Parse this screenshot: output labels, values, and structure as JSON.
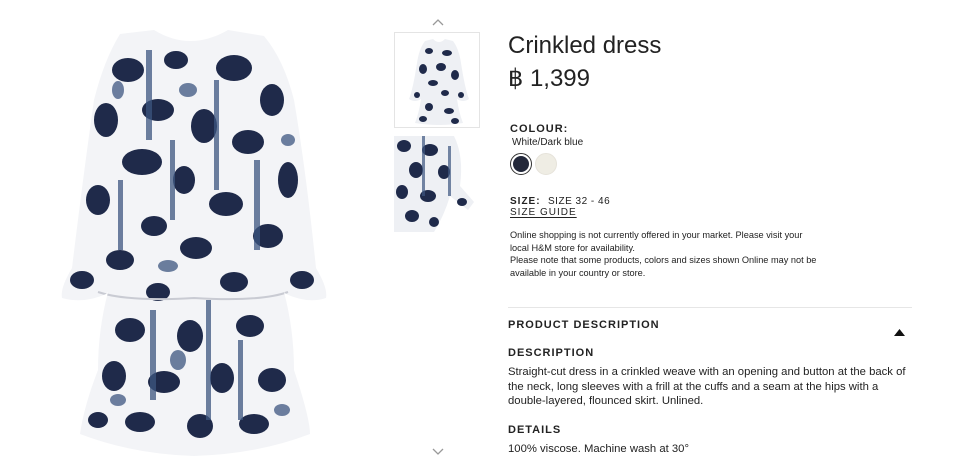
{
  "product": {
    "title": "Crinkled dress",
    "price": "฿ 1,399"
  },
  "colour": {
    "label": "COLOUR:",
    "selected": "White/Dark blue",
    "swatches": [
      {
        "name": "Dark blue",
        "color": "#23283a"
      },
      {
        "name": "White",
        "color": "#efede4"
      }
    ]
  },
  "size": {
    "label": "SIZE:",
    "value": "SIZE 32 - 46",
    "guide_link": "SIZE GUIDE"
  },
  "notice": {
    "lines": [
      "Online shopping is not currently offered in your market. Please visit your",
      "local H&M store for availability.",
      "Please note that some products, colors and sizes shown Online may not be",
      "available in your country or store."
    ]
  },
  "product_description": {
    "heading": "PRODUCT DESCRIPTION",
    "description_label": "DESCRIPTION",
    "description_text": "Straight-cut dress in a crinkled weave with an opening and button at the back of the neck, long sleeves with a frill at the cuffs and a seam at the hips with a double-layered, flounced skirt. Unlined.",
    "details_label": "DETAILS",
    "details_text": "100% viscose. Machine wash at 30°"
  },
  "icons": {
    "thumb_up": "chevron-up-icon",
    "thumb_down": "chevron-down-icon",
    "accordion": "caret-up-icon"
  },
  "colors": {
    "print_dark": "#1f2a4a",
    "print_mid": "#3d5680",
    "text": "#222222"
  }
}
